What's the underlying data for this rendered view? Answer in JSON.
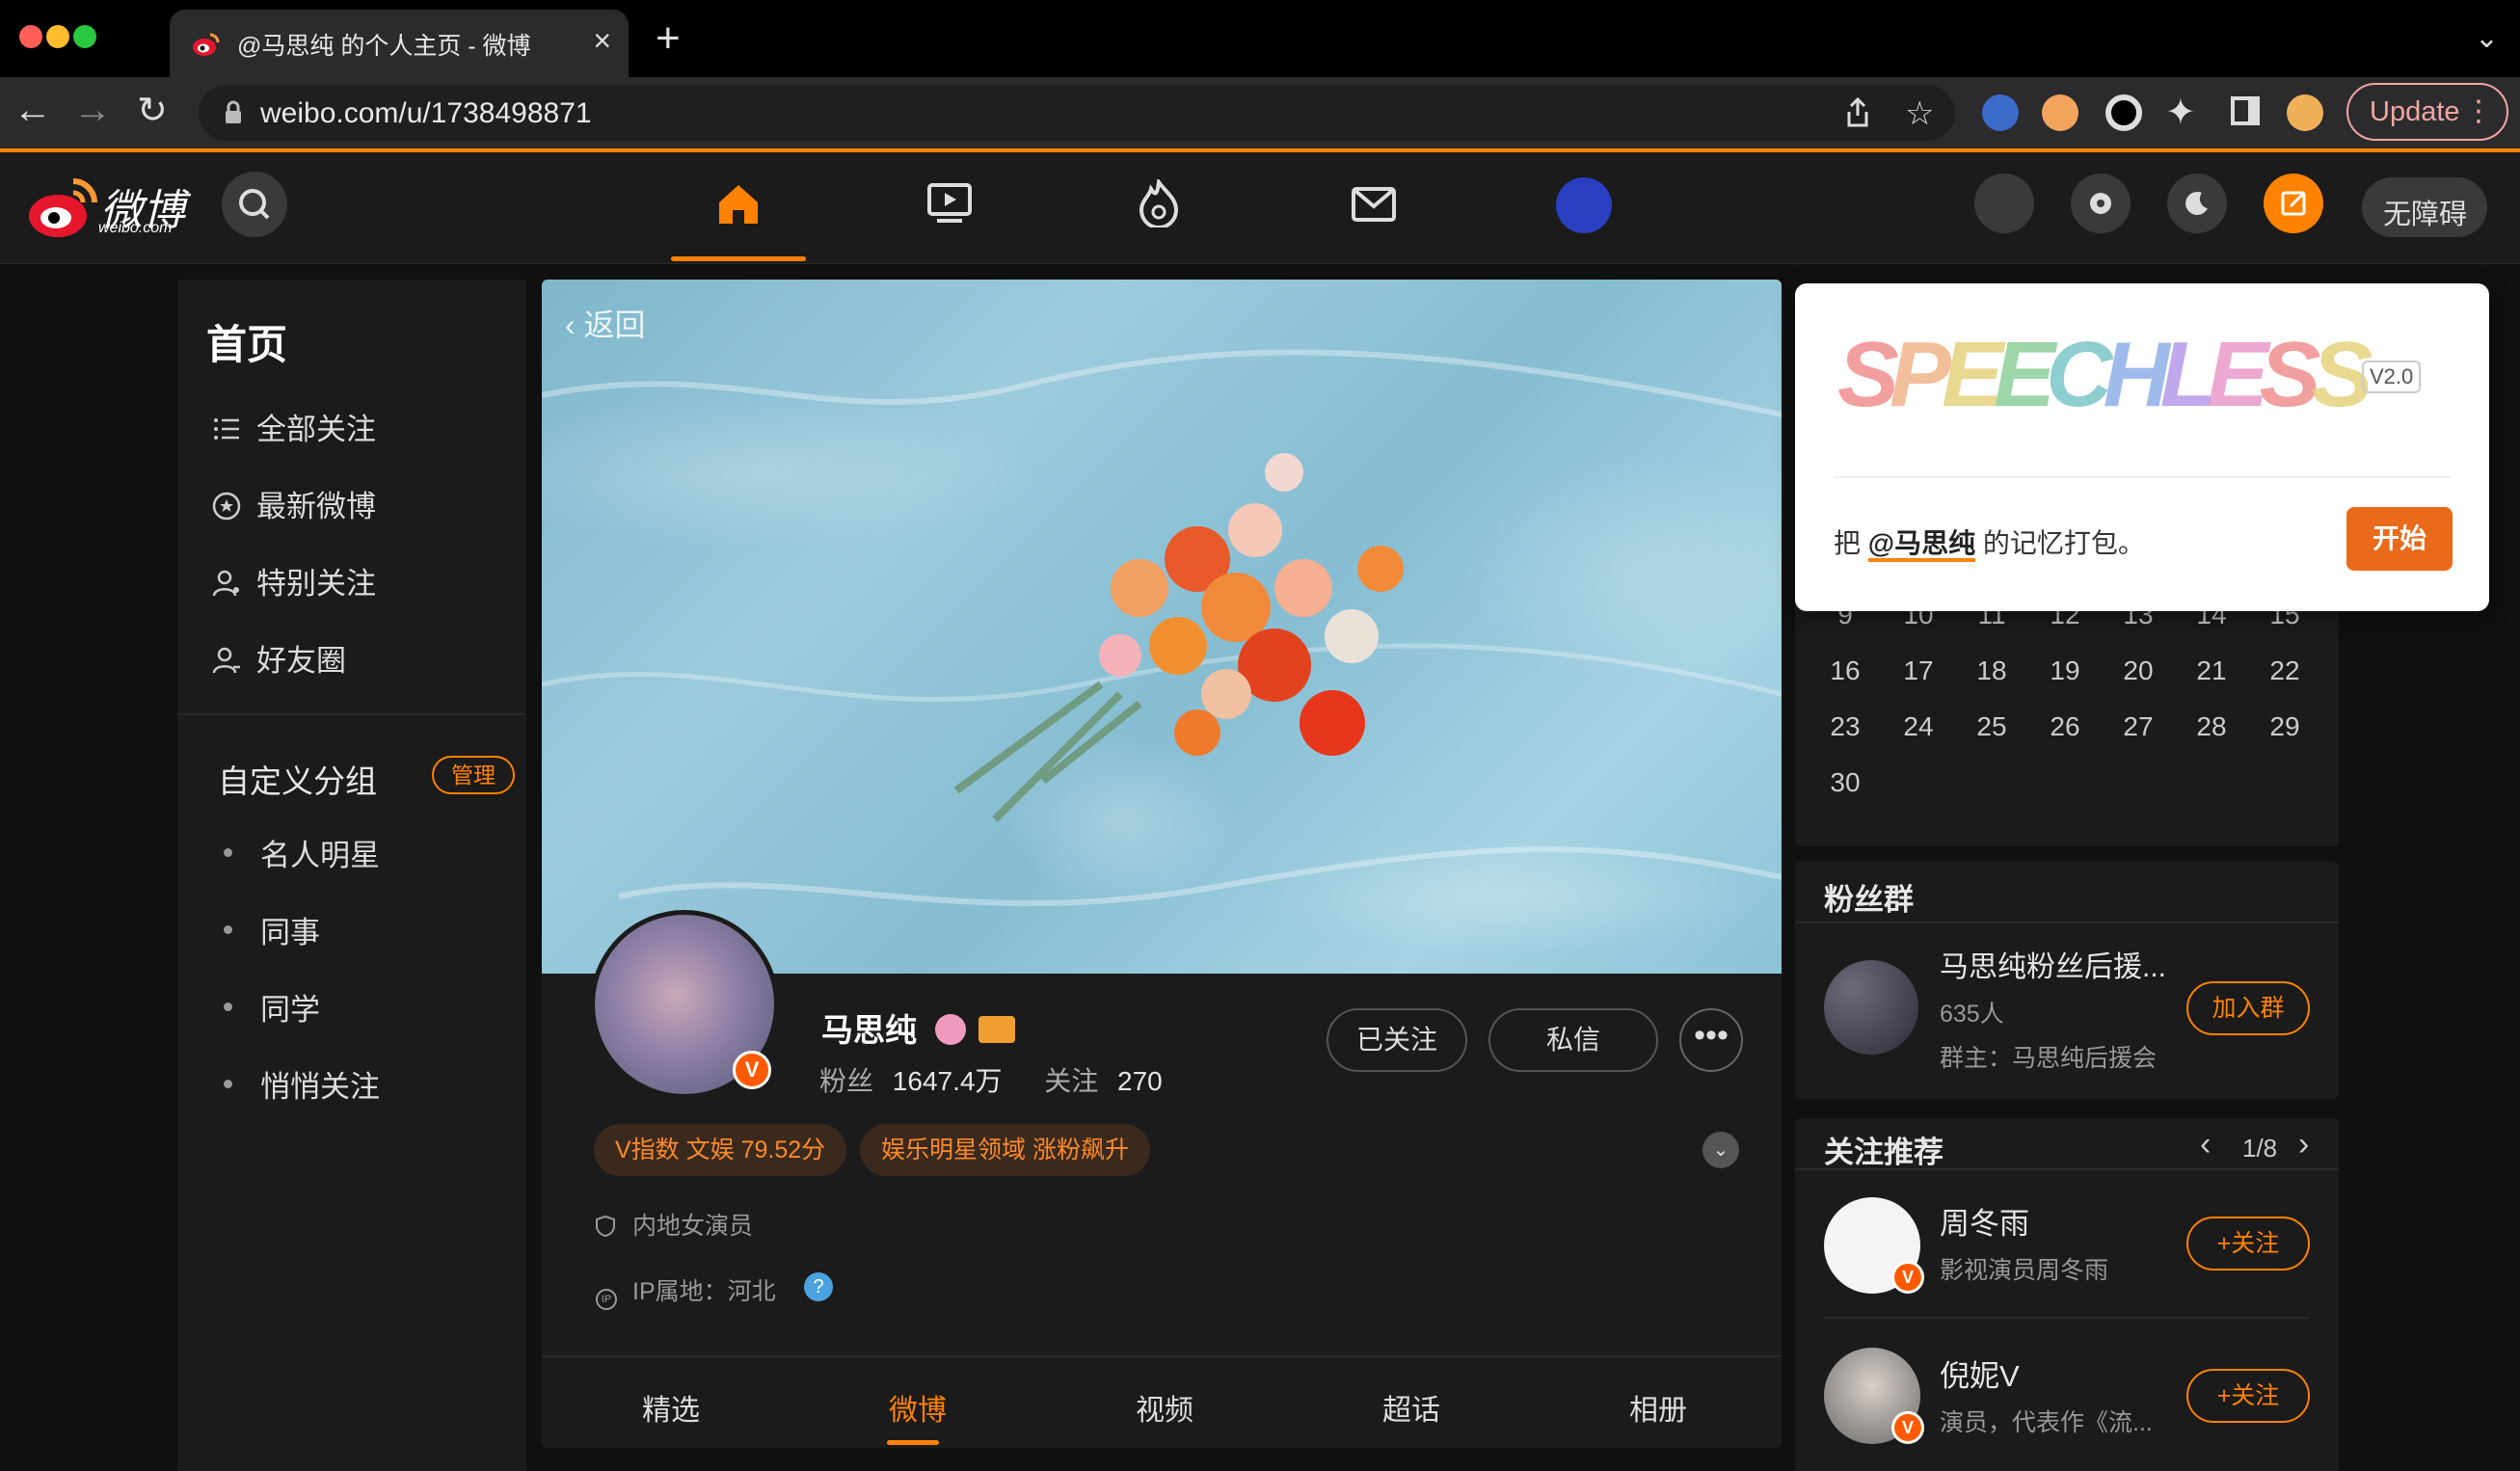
{
  "browser": {
    "tab_title": "@马思纯 的个人主页 - 微博",
    "new_tab": "+",
    "close": "×",
    "url": "weibo.com/u/1738498871",
    "update_label": "Update",
    "traffic_lights": [
      "#ff5f57",
      "#febc2e",
      "#28c840"
    ]
  },
  "weibo_nav": {
    "logo_text": "微博",
    "logo_sub": "weibo.com",
    "accent": "#ff8200",
    "nav_icons": [
      "home-icon",
      "video-icon",
      "hot-icon",
      "message-icon",
      "game-icon"
    ],
    "right_icons": [
      "gamepad-icon",
      "settings-icon",
      "dark-mode-icon",
      "compose-icon"
    ],
    "a11y_label": "无障碍"
  },
  "sidebar": {
    "home_title": "首页",
    "items": [
      {
        "label": "全部关注",
        "icon": "list-icon"
      },
      {
        "label": "最新微博",
        "icon": "star-circle-icon"
      },
      {
        "label": "特别关注",
        "icon": "user-star-icon"
      },
      {
        "label": "好友圈",
        "icon": "user-friends-icon"
      }
    ],
    "group_title": "自定义分组",
    "manage_label": "管理",
    "groups": [
      "名人明星",
      "同事",
      "同学",
      "悄悄关注"
    ]
  },
  "profile": {
    "back_label": "返回",
    "name": "马思纯",
    "verified_badge": "V",
    "fans_label": "粉丝",
    "fans_value": "1647.4万",
    "following_label": "关注",
    "following_value": "270",
    "followed_btn": "已关注",
    "message_btn": "私信",
    "more_btn": "•••",
    "tags": [
      "V指数 文娱 79.52分",
      "娱乐明星领域 涨粉飙升"
    ],
    "info_role": "内地女演员",
    "info_ip": "IP属地：河北",
    "help": "?",
    "tabs": [
      "精选",
      "微博",
      "视频",
      "超话",
      "相册"
    ],
    "active_tab": "微博"
  },
  "calendar": {
    "rows": [
      [
        "9",
        "10",
        "11",
        "12",
        "13",
        "14",
        "15"
      ],
      [
        "16",
        "17",
        "18",
        "19",
        "20",
        "21",
        "22"
      ],
      [
        "23",
        "24",
        "25",
        "26",
        "27",
        "28",
        "29"
      ],
      [
        "30"
      ]
    ]
  },
  "fans_group": {
    "title": "粉丝群",
    "name": "马思纯粉丝后援...",
    "count": "635人",
    "owner": "群主：马思纯后援会",
    "join_label": "加入群"
  },
  "recommend": {
    "title": "关注推荐",
    "page": "1/8",
    "prev": "‹",
    "next": "›",
    "users": [
      {
        "name": "周冬雨",
        "desc": "影视演员周冬雨",
        "follow_label": "+关注"
      },
      {
        "name": "倪妮V",
        "desc": "演员，代表作《流...",
        "follow_label": "+关注"
      }
    ]
  },
  "popup": {
    "logo": "SPEECHLESS",
    "version": "V2.0",
    "text_prefix": "把 ",
    "mention": "@马思纯",
    "text_suffix": " 的记忆打包。",
    "start_label": "开始"
  }
}
